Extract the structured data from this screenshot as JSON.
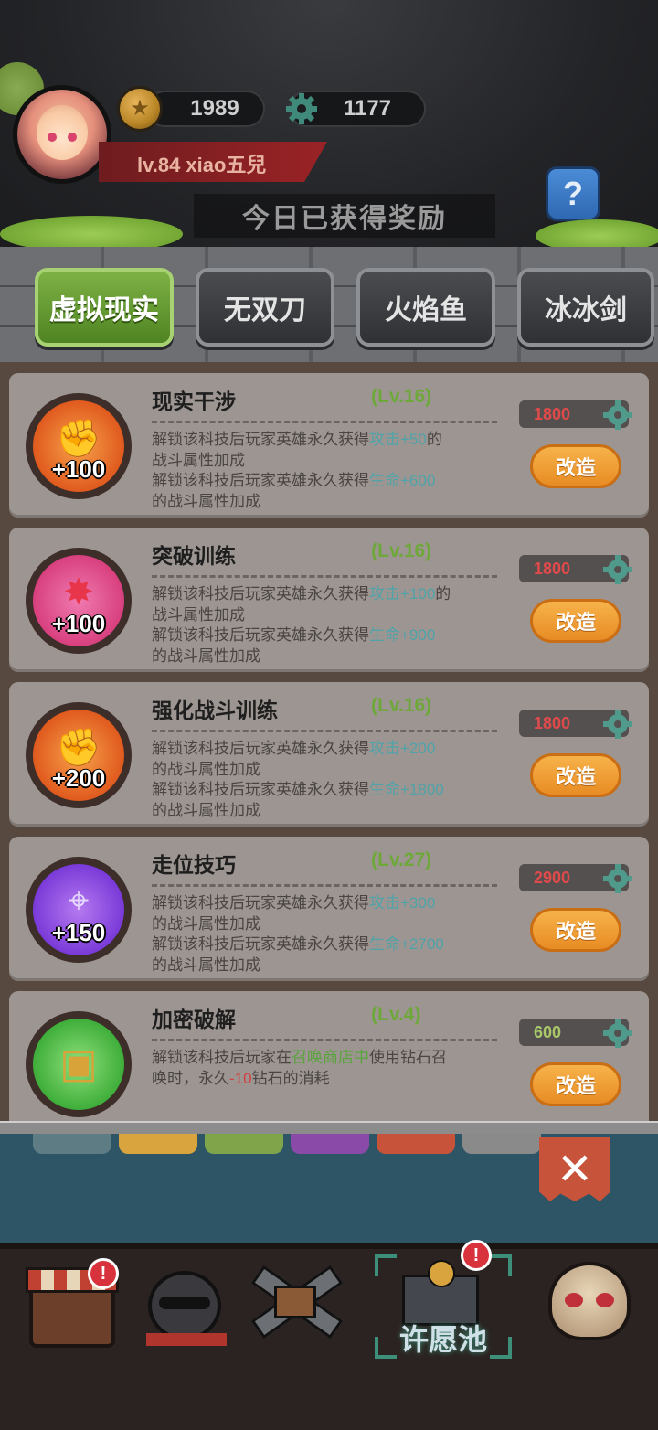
{
  "header": {
    "coins": "1989",
    "gears": "1177",
    "level_text": "lv.84  xiao五兒",
    "help_label": "?",
    "today_rewards_label": "今日已获得奖励"
  },
  "tabs": [
    {
      "label": "虚拟现实",
      "active": true
    },
    {
      "label": "无双刀",
      "active": false
    },
    {
      "label": "火焰鱼",
      "active": false
    },
    {
      "label": "冰冰剑",
      "active": false
    }
  ],
  "techs": [
    {
      "title": "现实干涉",
      "level": "(Lv.16)",
      "bonus": "+100",
      "icon": "fist-icon",
      "line1_pre": "解锁该科技后玩家英雄永久获得",
      "line1_hl": "攻击",
      "line1_val": "+50",
      "line1_post": "的",
      "line2": "战斗属性加成",
      "line3_pre": "解锁该科技后玩家英雄永久获得",
      "line3_hl": "生命",
      "line3_val": "+600",
      "line4": "的战斗属性加成",
      "cost": "1800",
      "cost_color": "#e04a4a",
      "button": "改造"
    },
    {
      "title": "突破训练",
      "level": "(Lv.16)",
      "bonus": "+100",
      "icon": "burst-icon",
      "line1_pre": "解锁该科技后玩家英雄永久获得",
      "line1_hl": "攻击",
      "line1_val": "+100",
      "line1_post": "的",
      "line2": "战斗属性加成",
      "line3_pre": "解锁该科技后玩家英雄永久获得",
      "line3_hl": "生命",
      "line3_val": "+900",
      "line4": "的战斗属性加成",
      "cost": "1800",
      "cost_color": "#e04a4a",
      "button": "改造"
    },
    {
      "title": "强化战斗训练",
      "level": "(Lv.16)",
      "bonus": "+200",
      "icon": "fist-icon",
      "line1_pre": "解锁该科技后玩家英雄永久获得",
      "line1_hl": "攻击",
      "line1_val": "+200",
      "line1_post": "",
      "line2": "的战斗属性加成",
      "line3_pre": "解锁该科技后玩家英雄永久获得",
      "line3_hl": "生命",
      "line3_val": "+1800",
      "line4": "的战斗属性加成",
      "cost": "1800",
      "cost_color": "#e04a4a",
      "button": "改造"
    },
    {
      "title": "走位技巧",
      "level": "(Lv.27)",
      "bonus": "+150",
      "icon": "crosshair-icon",
      "line1_pre": "解锁该科技后玩家英雄永久获得",
      "line1_hl": "攻击",
      "line1_val": "+300",
      "line1_post": "",
      "line2": "的战斗属性加成",
      "line3_pre": "解锁该科技后玩家英雄永久获得",
      "line3_hl": "生命",
      "line3_val": "+2700",
      "line4": "的战斗属性加成",
      "cost": "2900",
      "cost_color": "#e04a4a",
      "button": "改造"
    }
  ],
  "tech5": {
    "title": "加密破解",
    "level": "(Lv.4)",
    "icon": "chest-icon",
    "desc_pre": "解锁该科技后玩家在",
    "desc_hl": "召唤商店中",
    "desc_mid": "使用钻石召",
    "desc_line2_pre": "唤时，永久",
    "desc_line2_val": "-10",
    "desc_line2_post": "钻石的消耗",
    "cost": "600",
    "cost_color": "#a8c86a",
    "button": "改造"
  },
  "bottom_nav": {
    "wishing_pool_label": "许愿池",
    "badge": "!",
    "close_label": "✕"
  }
}
